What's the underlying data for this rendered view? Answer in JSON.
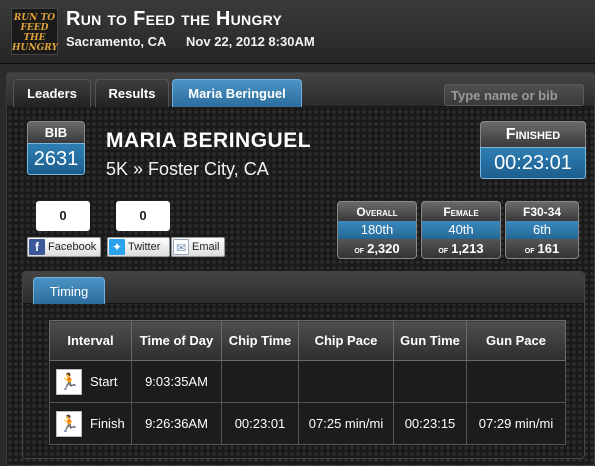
{
  "header": {
    "logo_lines": [
      "RUN TO",
      "FEED THE",
      "HUNGRY"
    ],
    "title": "Run to Feed the Hungry",
    "location": "Sacramento, CA",
    "datetime": "Nov 22, 2012 8:30AM"
  },
  "tabs": [
    {
      "label": "Leaders"
    },
    {
      "label": "Results"
    },
    {
      "label": "Maria Beringuel",
      "active": true
    }
  ],
  "search": {
    "placeholder": "Type name or bib"
  },
  "runner": {
    "bib_label": "BIB",
    "bib": "2631",
    "name": "MARIA BERINGUEL",
    "subtitle": "5K » Foster City, CA",
    "finished_label": "Finished",
    "finish_time": "00:23:01"
  },
  "social": [
    {
      "count": "0",
      "label": "Facebook",
      "icon": "facebook-icon",
      "color": "#3b5998"
    },
    {
      "count": "0",
      "label": "Twitter",
      "icon": "twitter-icon",
      "color": "#2aa3ef"
    },
    {
      "label": "Email",
      "icon": "email-icon"
    }
  ],
  "placements": [
    {
      "label": "Overall",
      "rank": "180th",
      "of_label": "of",
      "total": "2,320"
    },
    {
      "label": "Female",
      "rank": "40th",
      "of_label": "of",
      "total": "1,213"
    },
    {
      "label": "F30-34",
      "rank": "6th",
      "of_label": "of",
      "total": "161"
    }
  ],
  "timing": {
    "tab_label": "Timing",
    "columns": [
      "Interval",
      "Time of Day",
      "Chip Time",
      "Chip Pace",
      "Gun Time",
      "Gun Pace"
    ],
    "rows": [
      {
        "interval": "Start",
        "time_of_day": "9:03:35AM",
        "chip_time": "",
        "chip_pace": "",
        "gun_time": "",
        "gun_pace": ""
      },
      {
        "interval": "Finish",
        "time_of_day": "9:26:36AM",
        "chip_time": "00:23:01",
        "chip_pace": "07:25 min/mi",
        "gun_time": "00:23:15",
        "gun_pace": "07:29 min/mi"
      }
    ]
  },
  "colors": {
    "accent": "#2c7bb0",
    "background": "#1a1a1a"
  }
}
